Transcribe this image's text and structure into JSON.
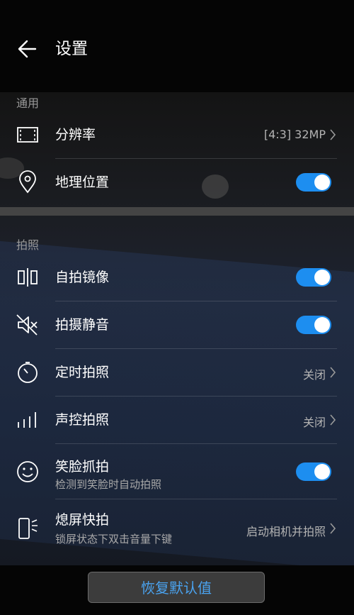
{
  "header": {
    "title": "设置",
    "back_icon": "arrow-left-icon"
  },
  "sections": {
    "general": "通用",
    "photo": "拍照"
  },
  "rows": [
    {
      "label": "分辨率",
      "value": "[4:3] 32MP",
      "icon": "resolution-icon",
      "control": "chevron"
    },
    {
      "label": "地理位置",
      "icon": "location-pin-icon",
      "control": "toggle",
      "on": true
    },
    {
      "label": "自拍镜像",
      "icon": "mirror-icon",
      "control": "toggle",
      "on": true
    },
    {
      "label": "拍摄静音",
      "icon": "mute-speaker-icon",
      "control": "toggle",
      "on": true
    },
    {
      "label": "定时拍照",
      "value": "关闭",
      "icon": "timer-icon",
      "control": "chevron"
    },
    {
      "label": "声控拍照",
      "value": "关闭",
      "icon": "sound-level-icon",
      "control": "chevron"
    },
    {
      "label": "笑脸抓拍",
      "sub": "检测到笑脸时自动拍照",
      "icon": "smile-icon",
      "control": "toggle",
      "on": true
    },
    {
      "label": "熄屏快拍",
      "sub": "锁屏状态下双击音量下键",
      "value": "启动相机并拍照",
      "icon": "phone-volume-icon",
      "control": "chevron"
    }
  ],
  "footer": {
    "reset_label": "恢复默认值"
  },
  "colors": {
    "accent": "#1d8ef0",
    "reset_text": "#4aa3f0"
  }
}
